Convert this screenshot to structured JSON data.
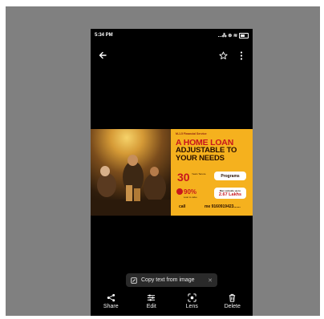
{
  "status_bar": {
    "time": "5:34 PM",
    "icons_text": "...⁂ ⊚ ≋"
  },
  "top_bar": {
    "back_icon": "arrow-left-icon",
    "favorite_icon": "star-outline-icon",
    "more_icon": "kebab-menu-icon"
  },
  "ad": {
    "brand": "M-1.5 Financial Service",
    "headline_1": "A HOME LOAN",
    "headline_2a": "ADJUSTABLE TO",
    "headline_2b": "YOUR NEEDS",
    "years": "30",
    "years_sub": "Years Tenure",
    "programs": "Programs",
    "loan_to_value": "90%",
    "ltv_sub": "Loan to value",
    "subsidy_prefix": "Max subsidy up to",
    "subsidy_value": "2.67 Lakhs",
    "call_label": "call",
    "phone": "me 9160919423......"
  },
  "copy_text_chip": {
    "label": "Copy text from image"
  },
  "bottom_actions": [
    {
      "label": "Share"
    },
    {
      "label": "Edit"
    },
    {
      "label": "Lens"
    },
    {
      "label": "Delete"
    }
  ],
  "colors": {
    "frame": "#808080",
    "phone_bg": "#000000",
    "ad_yellow": "#f5b11e",
    "ad_red": "#c8161d"
  }
}
